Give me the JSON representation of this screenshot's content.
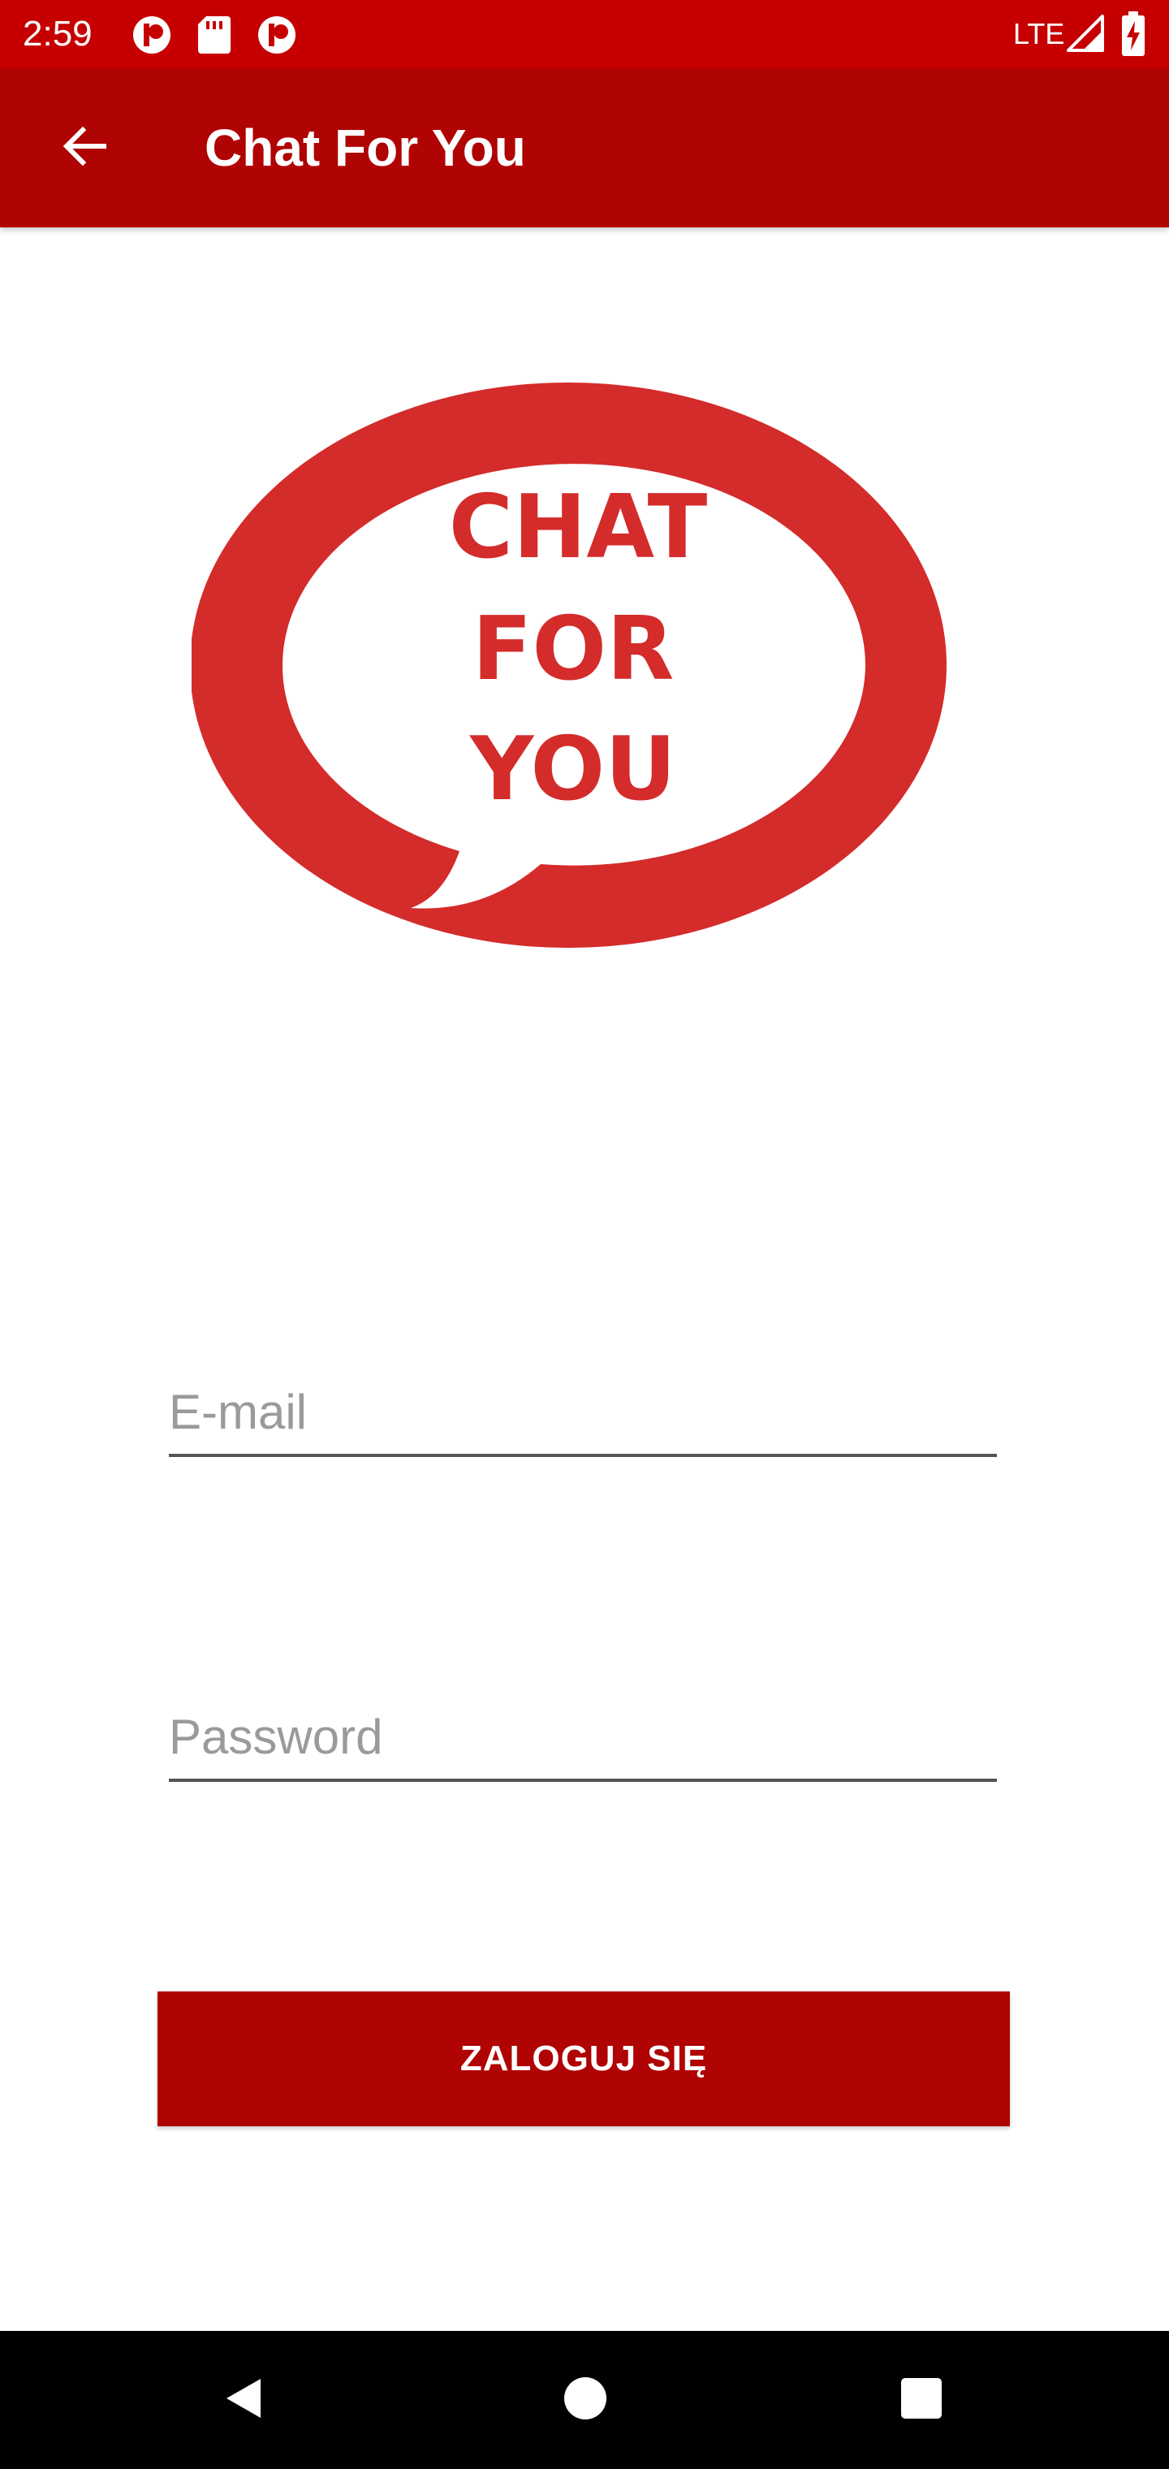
{
  "status_bar": {
    "time": "2:59",
    "network": "LTE",
    "icons": [
      "notification-p-icon",
      "sd-card-icon",
      "notification-p-icon",
      "signal-icon",
      "battery-charging-icon"
    ]
  },
  "app_bar": {
    "title": "Chat For You",
    "back_icon": "arrow-back-icon"
  },
  "logo": {
    "lines": [
      "CHAT",
      "FOR",
      "YOU"
    ],
    "color": "#d42b2b"
  },
  "form": {
    "email": {
      "placeholder": "E-mail",
      "value": ""
    },
    "password": {
      "placeholder": "Password",
      "value": ""
    },
    "submit_label": "ZALOGUJ SIĘ"
  },
  "nav_bar": {
    "icons": [
      "nav-back-icon",
      "nav-home-icon",
      "nav-recents-icon"
    ]
  },
  "colors": {
    "status_bar": "#c60000",
    "app_bar": "#b00303",
    "button": "#b00303",
    "logo_red": "#d42b2b"
  }
}
